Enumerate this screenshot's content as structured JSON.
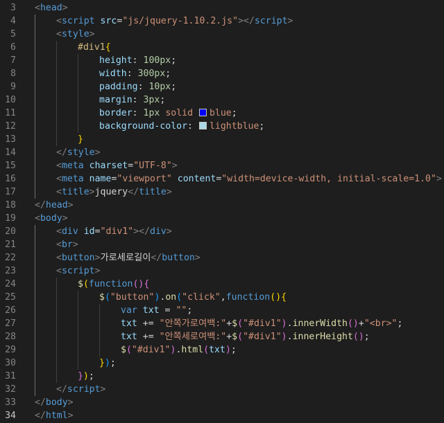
{
  "editor": {
    "colors": {
      "background": "#1e1e1e",
      "line_number": "#858585",
      "active_line_number": "#c6c6c6",
      "swatch_blue": "#0000ff",
      "swatch_lightblue": "#add8e6"
    },
    "lines": [
      {
        "n": "3",
        "indent": 0,
        "tokens": [
          [
            "punct",
            "<"
          ],
          [
            "tag",
            "head"
          ],
          [
            "punct",
            ">"
          ]
        ]
      },
      {
        "n": "4",
        "indent": 1,
        "tokens": [
          [
            "punct",
            "<"
          ],
          [
            "tag",
            "script"
          ],
          [
            "text",
            " "
          ],
          [
            "attr",
            "src"
          ],
          [
            "text",
            "="
          ],
          [
            "str",
            "\"js/jquery-1.10.2.js\""
          ],
          [
            "punct",
            "></"
          ],
          [
            "tag",
            "script"
          ],
          [
            "punct",
            ">"
          ]
        ]
      },
      {
        "n": "5",
        "indent": 1,
        "tokens": [
          [
            "punct",
            "<"
          ],
          [
            "tag",
            "style"
          ],
          [
            "punct",
            ">"
          ]
        ]
      },
      {
        "n": "6",
        "indent": 2,
        "tokens": [
          [
            "sel",
            "#div1"
          ],
          [
            "b1",
            "{"
          ]
        ]
      },
      {
        "n": "7",
        "indent": 3,
        "tokens": [
          [
            "prop",
            "height"
          ],
          [
            "plain",
            ": "
          ],
          [
            "num",
            "100px"
          ],
          [
            "plain",
            ";"
          ]
        ]
      },
      {
        "n": "8",
        "indent": 3,
        "tokens": [
          [
            "prop",
            "width"
          ],
          [
            "plain",
            ": "
          ],
          [
            "num",
            "300px"
          ],
          [
            "plain",
            ";"
          ]
        ]
      },
      {
        "n": "9",
        "indent": 3,
        "tokens": [
          [
            "prop",
            "padding"
          ],
          [
            "plain",
            ": "
          ],
          [
            "num",
            "10px"
          ],
          [
            "plain",
            ";"
          ]
        ]
      },
      {
        "n": "10",
        "indent": 3,
        "tokens": [
          [
            "prop",
            "margin"
          ],
          [
            "plain",
            ": "
          ],
          [
            "num",
            "3px"
          ],
          [
            "plain",
            ";"
          ]
        ]
      },
      {
        "n": "11",
        "indent": 3,
        "tokens": [
          [
            "prop",
            "border"
          ],
          [
            "plain",
            ": "
          ],
          [
            "num",
            "1px"
          ],
          [
            "plain",
            " "
          ],
          [
            "val",
            "solid"
          ],
          [
            "plain",
            " "
          ],
          [
            "swatch",
            "#0000ff"
          ],
          [
            "val",
            "blue"
          ],
          [
            "plain",
            ";"
          ]
        ]
      },
      {
        "n": "12",
        "indent": 3,
        "tokens": [
          [
            "prop",
            "background-color"
          ],
          [
            "plain",
            ": "
          ],
          [
            "swatch",
            "#add8e6"
          ],
          [
            "val",
            "lightblue"
          ],
          [
            "plain",
            ";"
          ]
        ]
      },
      {
        "n": "13",
        "indent": 2,
        "tokens": [
          [
            "b1",
            "}"
          ]
        ]
      },
      {
        "n": "14",
        "indent": 1,
        "tokens": [
          [
            "punct",
            "</"
          ],
          [
            "tag",
            "style"
          ],
          [
            "punct",
            ">"
          ]
        ]
      },
      {
        "n": "15",
        "indent": 1,
        "tokens": [
          [
            "punct",
            "<"
          ],
          [
            "tag",
            "meta"
          ],
          [
            "text",
            " "
          ],
          [
            "attr",
            "charset"
          ],
          [
            "text",
            "="
          ],
          [
            "str",
            "\"UTF-8\""
          ],
          [
            "punct",
            ">"
          ]
        ]
      },
      {
        "n": "16",
        "indent": 1,
        "tokens": [
          [
            "punct",
            "<"
          ],
          [
            "tag",
            "meta"
          ],
          [
            "text",
            " "
          ],
          [
            "attr",
            "name"
          ],
          [
            "text",
            "="
          ],
          [
            "str",
            "\"viewport\""
          ],
          [
            "text",
            " "
          ],
          [
            "attr",
            "content"
          ],
          [
            "text",
            "="
          ],
          [
            "str",
            "\"width=device-width, initial-scale=1.0\""
          ],
          [
            "punct",
            ">"
          ]
        ]
      },
      {
        "n": "17",
        "indent": 1,
        "tokens": [
          [
            "punct",
            "<"
          ],
          [
            "tag",
            "title"
          ],
          [
            "punct",
            ">"
          ],
          [
            "text",
            "jquery"
          ],
          [
            "punct",
            "</"
          ],
          [
            "tag",
            "title"
          ],
          [
            "punct",
            ">"
          ]
        ]
      },
      {
        "n": "18",
        "indent": 0,
        "tokens": [
          [
            "punct",
            "</"
          ],
          [
            "tag",
            "head"
          ],
          [
            "punct",
            ">"
          ]
        ]
      },
      {
        "n": "19",
        "indent": 0,
        "tokens": [
          [
            "punct",
            "<"
          ],
          [
            "tag",
            "body"
          ],
          [
            "punct",
            ">"
          ]
        ]
      },
      {
        "n": "20",
        "indent": 1,
        "tokens": [
          [
            "punct",
            "<"
          ],
          [
            "tag",
            "div"
          ],
          [
            "text",
            " "
          ],
          [
            "attr",
            "id"
          ],
          [
            "text",
            "="
          ],
          [
            "str",
            "\"div1\""
          ],
          [
            "punct",
            "></"
          ],
          [
            "tag",
            "div"
          ],
          [
            "punct",
            ">"
          ]
        ]
      },
      {
        "n": "21",
        "indent": 1,
        "tokens": [
          [
            "punct",
            "<"
          ],
          [
            "tag",
            "br"
          ],
          [
            "punct",
            ">"
          ]
        ]
      },
      {
        "n": "22",
        "indent": 1,
        "tokens": [
          [
            "punct",
            "<"
          ],
          [
            "tag",
            "button"
          ],
          [
            "punct",
            ">"
          ],
          [
            "text",
            "가로세로길이"
          ],
          [
            "punct",
            "</"
          ],
          [
            "tag",
            "button"
          ],
          [
            "punct",
            ">"
          ]
        ]
      },
      {
        "n": "23",
        "indent": 1,
        "tokens": [
          [
            "punct",
            "<"
          ],
          [
            "tag",
            "script"
          ],
          [
            "punct",
            ">"
          ]
        ]
      },
      {
        "n": "24",
        "indent": 2,
        "tokens": [
          [
            "fn",
            "$"
          ],
          [
            "b1",
            "("
          ],
          [
            "kw",
            "function"
          ],
          [
            "b2",
            "()"
          ],
          [
            "b2",
            "{"
          ]
        ]
      },
      {
        "n": "25",
        "indent": 3,
        "tokens": [
          [
            "fn",
            "$"
          ],
          [
            "b3",
            "("
          ],
          [
            "str",
            "\"button\""
          ],
          [
            "b3",
            ")"
          ],
          [
            "plain",
            "."
          ],
          [
            "fn",
            "on"
          ],
          [
            "b3",
            "("
          ],
          [
            "str",
            "\"click\""
          ],
          [
            "plain",
            ","
          ],
          [
            "kw",
            "function"
          ],
          [
            "b1",
            "()"
          ],
          [
            "b1",
            "{"
          ]
        ]
      },
      {
        "n": "26",
        "indent": 4,
        "tokens": [
          [
            "kw",
            "var"
          ],
          [
            "plain",
            " "
          ],
          [
            "var",
            "txt"
          ],
          [
            "plain",
            " = "
          ],
          [
            "str",
            "\"\""
          ],
          [
            "plain",
            ";"
          ]
        ]
      },
      {
        "n": "27",
        "indent": 4,
        "tokens": [
          [
            "var",
            "txt"
          ],
          [
            "plain",
            " += "
          ],
          [
            "str",
            "\"안쪽가로여백:\""
          ],
          [
            "plain",
            "+"
          ],
          [
            "fn",
            "$"
          ],
          [
            "b2",
            "("
          ],
          [
            "str",
            "\"#div1\""
          ],
          [
            "b2",
            ")"
          ],
          [
            "plain",
            "."
          ],
          [
            "fn",
            "innerWidth"
          ],
          [
            "b2",
            "()"
          ],
          [
            "plain",
            "+"
          ],
          [
            "str",
            "\"<br>\""
          ],
          [
            "plain",
            ";"
          ]
        ]
      },
      {
        "n": "28",
        "indent": 4,
        "tokens": [
          [
            "var",
            "txt"
          ],
          [
            "plain",
            " += "
          ],
          [
            "str",
            "\"안쪽세로여백:\""
          ],
          [
            "plain",
            "+"
          ],
          [
            "fn",
            "$"
          ],
          [
            "b2",
            "("
          ],
          [
            "str",
            "\"#div1\""
          ],
          [
            "b2",
            ")"
          ],
          [
            "plain",
            "."
          ],
          [
            "fn",
            "innerHeight"
          ],
          [
            "b2",
            "()"
          ],
          [
            "plain",
            ";"
          ]
        ]
      },
      {
        "n": "29",
        "indent": 4,
        "tokens": [
          [
            "fn",
            "$"
          ],
          [
            "b2",
            "("
          ],
          [
            "str",
            "\"#div1\""
          ],
          [
            "b2",
            ")"
          ],
          [
            "plain",
            "."
          ],
          [
            "fn",
            "html"
          ],
          [
            "b2",
            "("
          ],
          [
            "var",
            "txt"
          ],
          [
            "b2",
            ")"
          ],
          [
            "plain",
            ";"
          ]
        ]
      },
      {
        "n": "30",
        "indent": 3,
        "tokens": [
          [
            "b1",
            "}"
          ],
          [
            "b3",
            ")"
          ],
          [
            "plain",
            ";"
          ]
        ]
      },
      {
        "n": "31",
        "indent": 2,
        "tokens": [
          [
            "b2",
            "}"
          ],
          [
            "b1",
            ")"
          ],
          [
            "plain",
            ";"
          ]
        ]
      },
      {
        "n": "32",
        "indent": 1,
        "tokens": [
          [
            "punct",
            "</"
          ],
          [
            "tag",
            "script"
          ],
          [
            "punct",
            ">"
          ]
        ]
      },
      {
        "n": "33",
        "indent": 0,
        "tokens": [
          [
            "punct",
            "</"
          ],
          [
            "tag",
            "body"
          ],
          [
            "punct",
            ">"
          ]
        ]
      },
      {
        "n": "34",
        "indent": 0,
        "active": true,
        "tokens": [
          [
            "punct",
            "</"
          ],
          [
            "tag",
            "html"
          ],
          [
            "punct",
            ">"
          ]
        ]
      }
    ]
  }
}
